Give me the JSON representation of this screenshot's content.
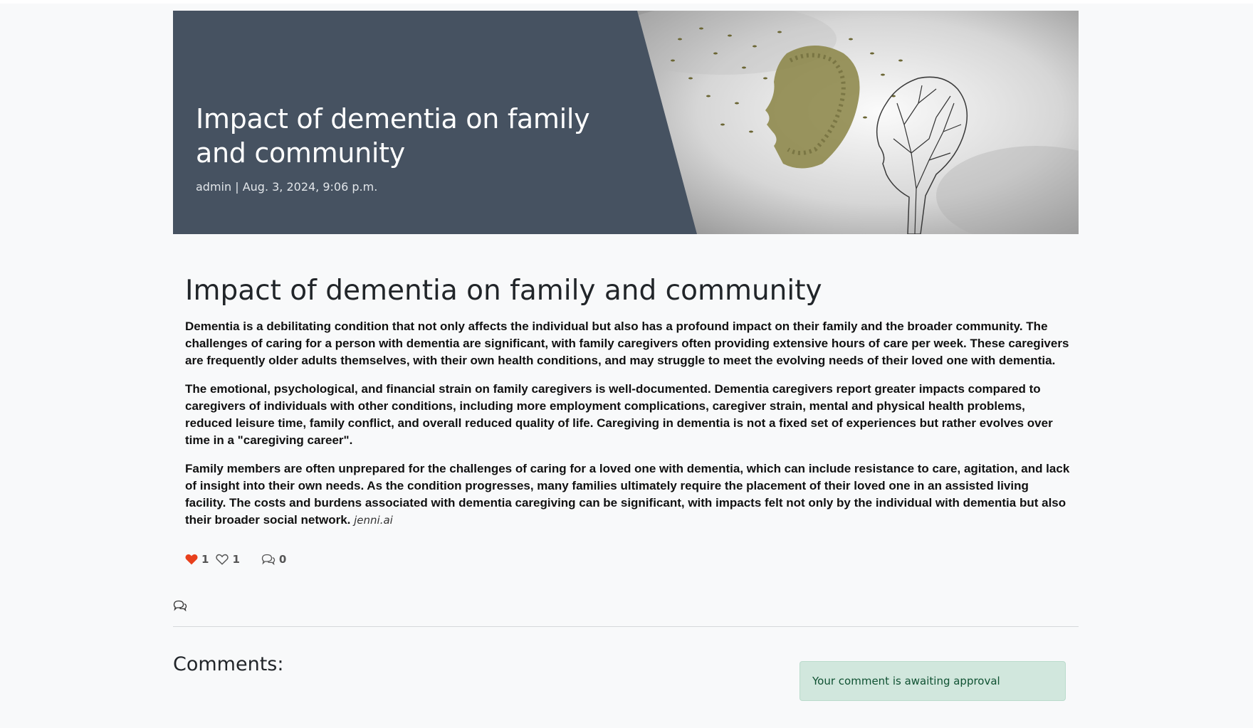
{
  "hero": {
    "title": "Impact of dementia on family and community",
    "meta": "admin | Aug. 3, 2024, 9:06 p.m.",
    "image_icon": "dementia-head-leaves-image"
  },
  "article": {
    "title": "Impact of dementia on family and community",
    "paragraphs": [
      "Dementia is a debilitating condition that not only affects the individual but also has a profound impact on their family and the broader community. The challenges of caring for a person with dementia are significant, with family caregivers often providing extensive hours of care per week. These caregivers are frequently older adults themselves, with their own health conditions, and may struggle to meet the evolving needs of their loved one with dementia.",
      "The emotional, psychological, and financial strain on family caregivers is well-documented. Dementia caregivers report greater impacts compared to caregivers of individuals with other conditions, including more employment complications, caregiver strain, mental and physical health problems, reduced leisure time, family conflict, and overall reduced quality of life. Caregiving in dementia is not a fixed set of experiences but rather evolves over time in a \"caregiving career\".",
      "Family members are often unprepared for the challenges of caring for a loved one with dementia, which can include resistance to care, agitation, and lack of insight into their own needs. As the condition progresses, many families ultimately require the placement of their loved one in an assisted living facility. The costs and burdens associated with dementia caregiving can be significant, with impacts felt not only by the individual with dementia but also their broader social network."
    ],
    "source": "jenni.ai"
  },
  "actions": {
    "like_count": "1",
    "unlike_count": "1",
    "comment_count": "0",
    "like_color": "#e8401c"
  },
  "comments": {
    "heading": "Comments:",
    "alert": "Your comment is awaiting approval"
  }
}
